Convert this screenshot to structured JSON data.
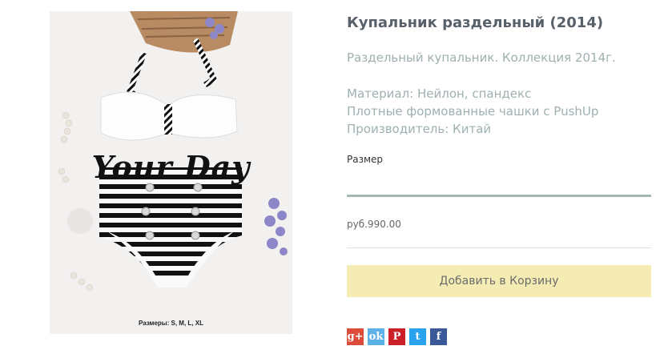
{
  "product": {
    "title": "Купальник раздельный (2014)",
    "short_description": "Раздельный купальник. Коллекция 2014г.",
    "specs": [
      "Материал: Нейлон, спандекс",
      "Плотные формованные чашки с PushUp",
      "Производитель: Китай"
    ],
    "image": {
      "watermark": "Your Day",
      "caption": "Размеры: S, M, L, XL"
    }
  },
  "options": {
    "size_label": "Размер"
  },
  "price": "руб.990.00",
  "cart": {
    "button_label": "Добавить в Корзину"
  },
  "share": [
    {
      "name": "google-plus-icon",
      "glyph": "g+",
      "color": "#dd4b39"
    },
    {
      "name": "odnoklassniki-icon",
      "glyph": "ok",
      "color": "#5bb1e8"
    },
    {
      "name": "pinterest-icon",
      "glyph": "P",
      "color": "#cb2027"
    },
    {
      "name": "twitter-icon",
      "glyph": "t",
      "color": "#2aa3ef"
    },
    {
      "name": "facebook-icon",
      "glyph": "f",
      "color": "#3b5998"
    }
  ]
}
